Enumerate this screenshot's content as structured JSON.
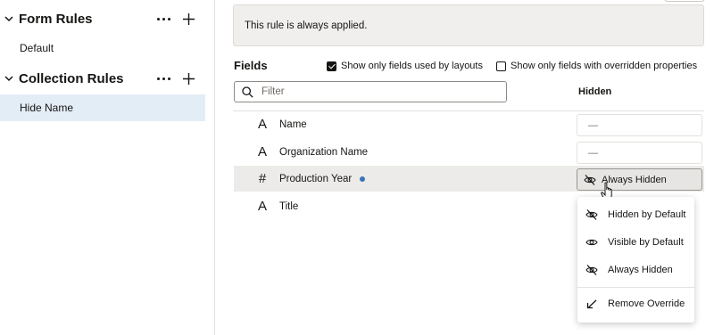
{
  "sidebar": {
    "sections": [
      {
        "title": "Form Rules",
        "items": [
          "Default"
        ]
      },
      {
        "title": "Collection Rules",
        "items": [
          "Hide Name"
        ]
      }
    ]
  },
  "banner": {
    "text": "This rule is always applied."
  },
  "fields": {
    "title": "Fields",
    "checkbox_layouts": {
      "label": "Show only fields used by layouts",
      "checked": true
    },
    "checkbox_overridden": {
      "label": "Show only fields with overridden properties",
      "checked": false
    },
    "filter": {
      "placeholder": "Filter",
      "value": ""
    },
    "hidden_header": "Hidden",
    "rows": [
      {
        "type_icon": "text-type-icon",
        "type_glyph": "A",
        "name": "Name",
        "hidden": "—"
      },
      {
        "type_icon": "text-type-icon",
        "type_glyph": "A",
        "name": "Organization Name",
        "hidden": "—"
      },
      {
        "type_icon": "number-type-icon",
        "type_glyph": "#",
        "name": "Production Year",
        "hidden": "Always Hidden",
        "overridden": true
      },
      {
        "type_icon": "text-type-icon",
        "type_glyph": "A",
        "name": "Title",
        "hidden": ""
      }
    ]
  },
  "menu": {
    "items": [
      {
        "label": "Hidden by Default",
        "icon": "eye-slash-icon"
      },
      {
        "label": "Visible by Default",
        "icon": "eye-icon"
      },
      {
        "label": "Always Hidden",
        "icon": "eye-slash-icon"
      },
      {
        "label": "Remove Override",
        "icon": "undo-arrow-icon"
      }
    ]
  },
  "colors": {
    "selected_bg": "#e3edf6",
    "override_dot": "#3a74b5",
    "banner_bg": "#f1efed"
  }
}
